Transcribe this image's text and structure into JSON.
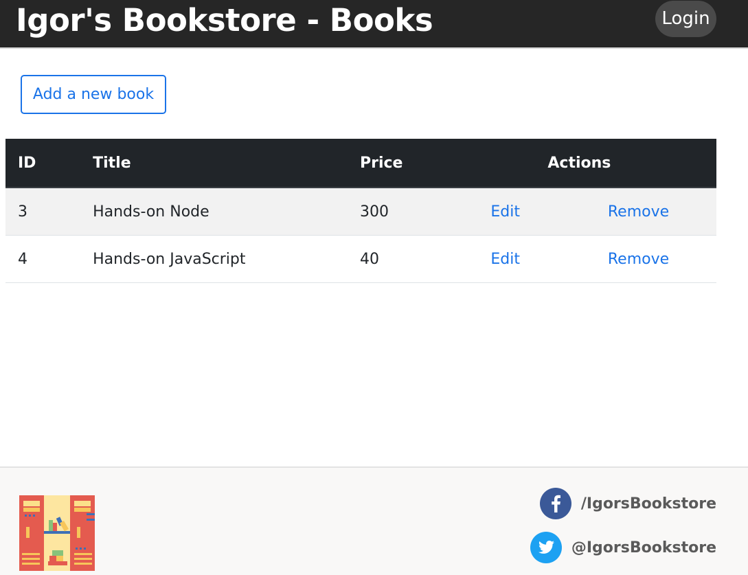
{
  "header": {
    "title": "Igor's Bookstore - Books",
    "login_label": "Login",
    "background": "#262626"
  },
  "toolbar": {
    "add_label": "Add a new book",
    "accent": "#1a73e8"
  },
  "table": {
    "columns": [
      "ID",
      "Title",
      "Price",
      "Actions"
    ],
    "rows": [
      {
        "id": "3",
        "title": "Hands-on Node",
        "price": "300",
        "edit": "Edit",
        "remove": "Remove"
      },
      {
        "id": "4",
        "title": "Hands-on JavaScript",
        "price": "40",
        "edit": "Edit",
        "remove": "Remove"
      }
    ],
    "header_bg": "#212529"
  },
  "footer": {
    "logo_icon": "bookshelf-logo-icon",
    "facebook": {
      "icon": "facebook-icon",
      "handle": "/IgorsBookstore",
      "color": "#3b5998"
    },
    "twitter": {
      "icon": "twitter-icon",
      "handle": "@IgorsBookstore",
      "color": "#1da1f2"
    }
  }
}
